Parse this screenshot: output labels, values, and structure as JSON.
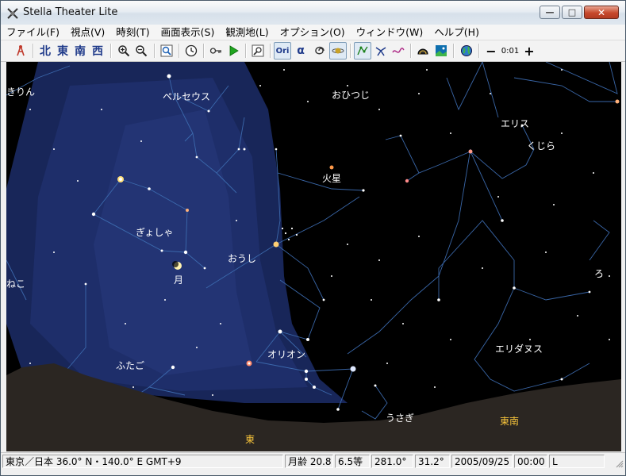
{
  "window": {
    "title": "Stella Theater Lite",
    "minimize_glyph": "—",
    "maximize_glyph": "□",
    "close_glyph": "✕"
  },
  "menu": [
    "ファイル(F)",
    "視点(V)",
    "時刻(T)",
    "画面表示(S)",
    "観測地(L)",
    "オプション(O)",
    "ウィンドウ(W)",
    "ヘルプ(H)"
  ],
  "toolbar": {
    "north": "北",
    "east": "東",
    "south": "南",
    "west": "西",
    "ori_label": "Ori",
    "alpha_label": "α",
    "step_label": "0:01",
    "minus_label": "−",
    "plus_label": "+"
  },
  "sky": {
    "constellations": {
      "kirin": "きりん",
      "perseus": "ペルセウス",
      "ohitsuji": "おひつじ",
      "eris": "エリス",
      "kujira": "くじら",
      "kasei": "火星",
      "gyosha": "ぎょしゃ",
      "oushi": "おうし",
      "tsuki": "月",
      "neko": "ねこ",
      "ro": "ろ",
      "orion": "オリオン",
      "futago": "ふたご",
      "eridanus": "エリダヌス",
      "usagi": "うさぎ"
    },
    "horizon": {
      "east": "東",
      "southeast": "東南"
    }
  },
  "status": {
    "location": "東京／日本  36.0° N・140.0° E  GMT+9",
    "moon_age": "月齢 20.8",
    "magnitude": "6.5等",
    "azimuth": "281.0°",
    "altitude": "31.2°",
    "date": "2005/09/25",
    "time": "00:00",
    "mode": "L"
  },
  "colors": {
    "sky": "#000000",
    "milky_way": "#1c2a66",
    "ground": "#2b2622",
    "constellation_line": "#3f6fb4",
    "label": "#ffffff",
    "direction_label": "#f5c23a"
  }
}
